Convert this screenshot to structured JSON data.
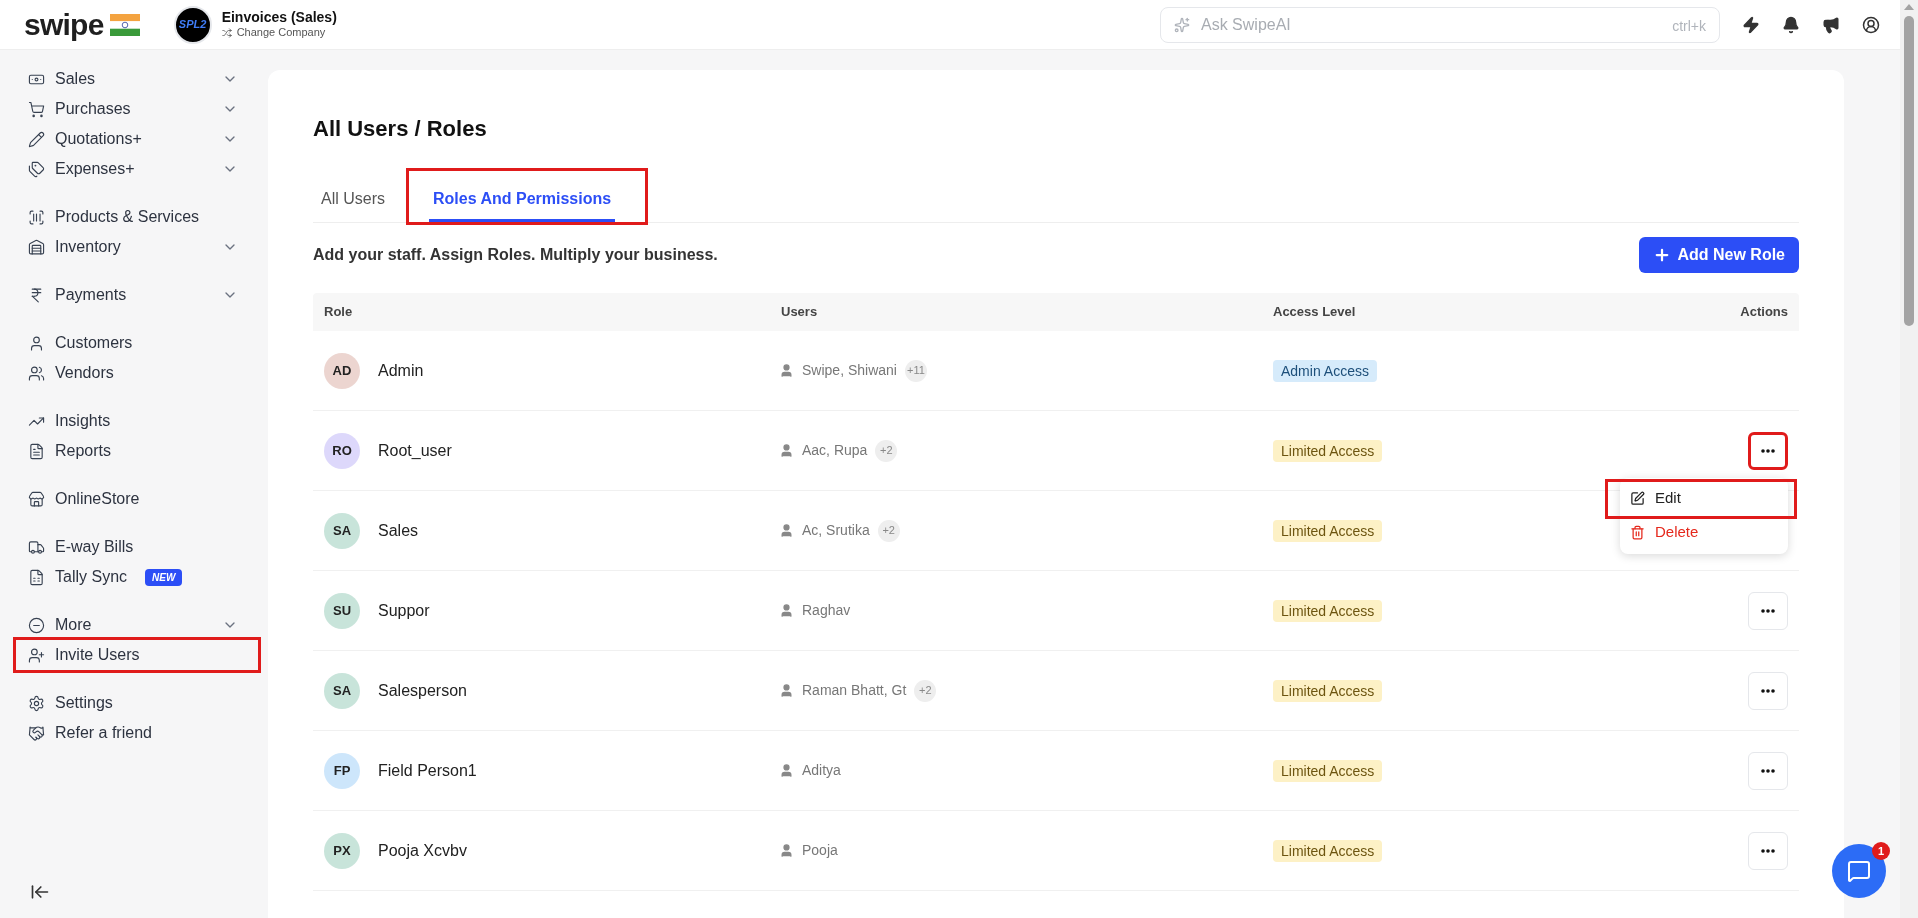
{
  "brand": {
    "name": "swipe"
  },
  "company": {
    "logo_text": "SPL2",
    "name": "Einvoices (Sales)",
    "switch_label": "Change Company"
  },
  "search": {
    "placeholder": "Ask SwipeAI",
    "shortcut": "ctrl+k"
  },
  "sidebar": {
    "sections": [
      [
        {
          "label": "Sales",
          "submenu": true,
          "highlighted": false
        },
        {
          "label": "Purchases",
          "submenu": true,
          "highlighted": false
        },
        {
          "label": "Quotations+",
          "submenu": true,
          "highlighted": false
        },
        {
          "label": "Expenses+",
          "submenu": true,
          "highlighted": false
        }
      ],
      [
        {
          "label": "Products & Services",
          "submenu": false,
          "highlighted": false
        },
        {
          "label": "Inventory",
          "submenu": true,
          "highlighted": false
        }
      ],
      [
        {
          "label": "Payments",
          "submenu": true,
          "highlighted": false
        }
      ],
      [
        {
          "label": "Customers",
          "submenu": false,
          "highlighted": false
        },
        {
          "label": "Vendors",
          "submenu": false,
          "highlighted": false
        }
      ],
      [
        {
          "label": "Insights",
          "submenu": false,
          "highlighted": false
        },
        {
          "label": "Reports",
          "submenu": false,
          "highlighted": false
        }
      ],
      [
        {
          "label": "OnlineStore",
          "submenu": false,
          "highlighted": false
        }
      ],
      [
        {
          "label": "E-way Bills",
          "submenu": false,
          "highlighted": false
        },
        {
          "label": "Tally Sync",
          "submenu": false,
          "highlighted": false,
          "badge": "NEW"
        }
      ],
      [
        {
          "label": "More",
          "submenu": true,
          "highlighted": false
        },
        {
          "label": "Invite Users",
          "submenu": false,
          "highlighted": true
        }
      ],
      [
        {
          "label": "Settings",
          "submenu": false,
          "highlighted": false
        },
        {
          "label": "Refer a friend",
          "submenu": false,
          "highlighted": false
        }
      ]
    ]
  },
  "page": {
    "title": "All Users / Roles",
    "tabs": [
      {
        "label": "All Users",
        "selected": false,
        "highlighted": false
      },
      {
        "label": "Roles And Permissions",
        "selected": true,
        "highlighted": true
      }
    ],
    "tagline": "Add your staff. Assign Roles. Multiply your business.",
    "add_button": "Add New Role"
  },
  "table": {
    "columns": [
      "Role",
      "Users",
      "Access Level",
      "Actions"
    ],
    "rows": [
      {
        "initials": "AD",
        "color": "#ecd5d0",
        "role": "Admin",
        "users": "Swipe, Shiwani",
        "more": "+11",
        "access": "Admin Access",
        "kind": "admin",
        "has_actions": false
      },
      {
        "initials": "RO",
        "color": "#ddd8fb",
        "role": "Root_user",
        "users": "Aac, Rupa",
        "more": "+2",
        "access": "Limited Access",
        "kind": "limited",
        "has_actions": true,
        "actions_highlighted": true,
        "menu_open": true
      },
      {
        "initials": "SA",
        "color": "#c8e4da",
        "role": "Sales",
        "users": "Ac, Srutika",
        "more": "+2",
        "access": "Limited Access",
        "kind": "limited",
        "has_actions": false
      },
      {
        "initials": "SU",
        "color": "#c8e4da",
        "role": "Suppor",
        "users": "Raghav",
        "access": "Limited Access",
        "kind": "limited",
        "has_actions": true,
        "actions_highlighted": false,
        "menu_open": false
      },
      {
        "initials": "SA",
        "color": "#c8e4da",
        "role": "Salesperson",
        "users": "Raman Bhatt, Gt",
        "more": "+2",
        "access": "Limited Access",
        "kind": "limited",
        "has_actions": true,
        "actions_highlighted": false,
        "menu_open": false
      },
      {
        "initials": "FP",
        "color": "#cde6fb",
        "role": "Field Person1",
        "users": "Aditya",
        "access": "Limited Access",
        "kind": "limited",
        "has_actions": true,
        "actions_highlighted": false,
        "menu_open": false
      },
      {
        "initials": "PX",
        "color": "#c8e4da",
        "role": "Pooja Xcvbv",
        "users": "Pooja",
        "access": "Limited Access",
        "kind": "limited",
        "has_actions": true,
        "actions_highlighted": false,
        "menu_open": false
      }
    ]
  },
  "action_menu": [
    {
      "label": "Edit",
      "kind": "edit",
      "highlighted": true
    },
    {
      "label": "Delete",
      "kind": "delete",
      "highlighted": false
    }
  ],
  "chat": {
    "badge": "1"
  }
}
